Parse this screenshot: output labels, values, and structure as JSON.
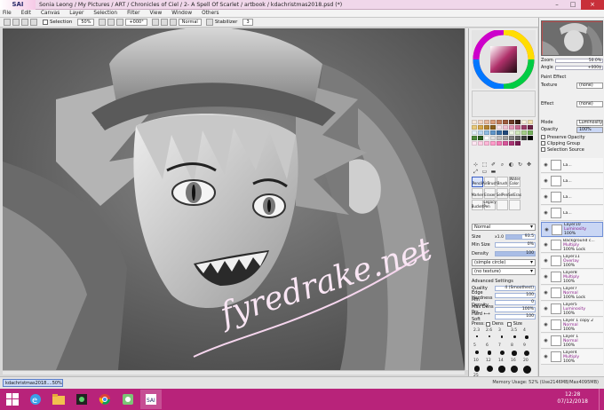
{
  "app": {
    "logo": "SAI",
    "title": "Sonia Leong / My Pictures / ART / Chronicles of Ciel / 2- A Spell Of Scarlet / artbook / kdachristmas2018.psd (*)",
    "window_buttons": [
      "–",
      "□",
      "×"
    ]
  },
  "menu": [
    "File",
    "Edit",
    "Canvas",
    "Layer",
    "Selection",
    "Filter",
    "View",
    "Window",
    "Others"
  ],
  "toolbar": {
    "selection_label": "Selection",
    "zoom": "50%",
    "rotation": "+000°",
    "blend": "Normal",
    "stabilizer_label": "Stabilizer",
    "stabilizer": "3"
  },
  "canvas": {
    "watermark": "fyredrake.net"
  },
  "tools_panel": {
    "tool_icons": [
      "⊹",
      "⬚",
      "✐",
      "⌕",
      "◐",
      "↻",
      "✥",
      "⤢",
      "▭",
      "▬"
    ],
    "brushes": [
      {
        "label": "Pencil",
        "selected": true
      },
      {
        "label": "AirBrush",
        "selected": false
      },
      {
        "label": "Brush",
        "selected": false
      },
      {
        "label": "Water Color",
        "selected": false
      },
      {
        "label": "Marker",
        "selected": false
      },
      {
        "label": "Eraser",
        "selected": false
      },
      {
        "label": "SelPen",
        "selected": false
      },
      {
        "label": "SelEras",
        "selected": false
      },
      {
        "label": "Bucket",
        "selected": false
      },
      {
        "label": "Legacy Pen",
        "selected": false
      },
      {
        "label": "",
        "selected": false
      },
      {
        "label": "",
        "selected": false
      }
    ],
    "blend_mode": "Normal",
    "size_label": "Size",
    "size_multiplier": "x1.0",
    "size_value": "93.5",
    "size_fill": 0.55,
    "min_size_label": "Min Size",
    "min_size_value": "0%",
    "density_label": "Density",
    "density_value": "100",
    "shape_option": "(simple circle)",
    "texture_option": "(no texture)",
    "advanced_label": "Advanced Settings",
    "quality_label": "Quality",
    "quality_value": "4 (Smoothest)",
    "edge_label": "Edge Hardness",
    "edge_value": "100",
    "min_density_label": "Min Density",
    "min_density_value": "0",
    "max_dens_label": "Max Dens Prs.",
    "max_dens_value": "100%",
    "hard_soft_label": "Hard ⟷ Soft",
    "hard_soft_value": "100",
    "press_label": "Press:",
    "press_dens": "Dens",
    "press_size": "Size",
    "dot_labels": [
      "2.3",
      "2.6",
      "3",
      "3.5",
      "4",
      "5",
      "6",
      "7",
      "8",
      "9",
      "10",
      "12",
      "14",
      "16",
      "20",
      "25"
    ]
  },
  "layers_panel": {
    "zoom_label": "Zoom",
    "zoom_value": "50.0%",
    "angle_label": "Angle",
    "angle_value": "+000$",
    "paint_effect_label": "Paint Effect",
    "texture_label": "Texture",
    "texture_value": "(none)",
    "effect_label": "Effect",
    "effect_value": "(none)",
    "mode_label": "Mode",
    "mode_value": "Luminosity",
    "opacity_label": "Opacity",
    "opacity_value": "100%",
    "checks": [
      "Preserve Opacity",
      "Clipping Group",
      "Selection Source"
    ],
    "layers": [
      {
        "name": "La...",
        "mode": "",
        "opacity": "",
        "selected": false
      },
      {
        "name": "La...",
        "mode": "",
        "opacity": "",
        "selected": false
      },
      {
        "name": "La...",
        "mode": "",
        "opacity": "",
        "selected": false
      },
      {
        "name": "La...",
        "mode": "",
        "opacity": "",
        "selected": false
      },
      {
        "name": "Layer10",
        "mode": "Luminosity",
        "opacity": "100%",
        "selected": true
      },
      {
        "name": "Background c...",
        "mode": "Multiply",
        "opacity": "100% Lock",
        "selected": false
      },
      {
        "name": "Layer11",
        "mode": "Overlay",
        "opacity": "100%",
        "selected": false
      },
      {
        "name": "Layer8",
        "mode": "Multiply",
        "opacity": "100%",
        "selected": false
      },
      {
        "name": "Layer7",
        "mode": "Normal",
        "opacity": "100% Lock",
        "selected": false
      },
      {
        "name": "Layer5",
        "mode": "Luminosity",
        "opacity": "100%",
        "selected": false
      },
      {
        "name": "Layer 1 copy 2",
        "mode": "Normal",
        "opacity": "100%",
        "selected": false
      },
      {
        "name": "Layer 1",
        "mode": "Normal",
        "opacity": "100%",
        "selected": false
      },
      {
        "name": "Layer4",
        "mode": "Multiply",
        "opacity": "100%",
        "selected": false
      }
    ]
  },
  "file_tab": {
    "name": "kdachristmas2018....",
    "zoom": "50%"
  },
  "memory": "Memory Usage: 52% (Use2146MB/Max4095MB)",
  "taskbar": {
    "time": "12:28",
    "date": "07/12/2018",
    "accent": "#b8237a"
  }
}
